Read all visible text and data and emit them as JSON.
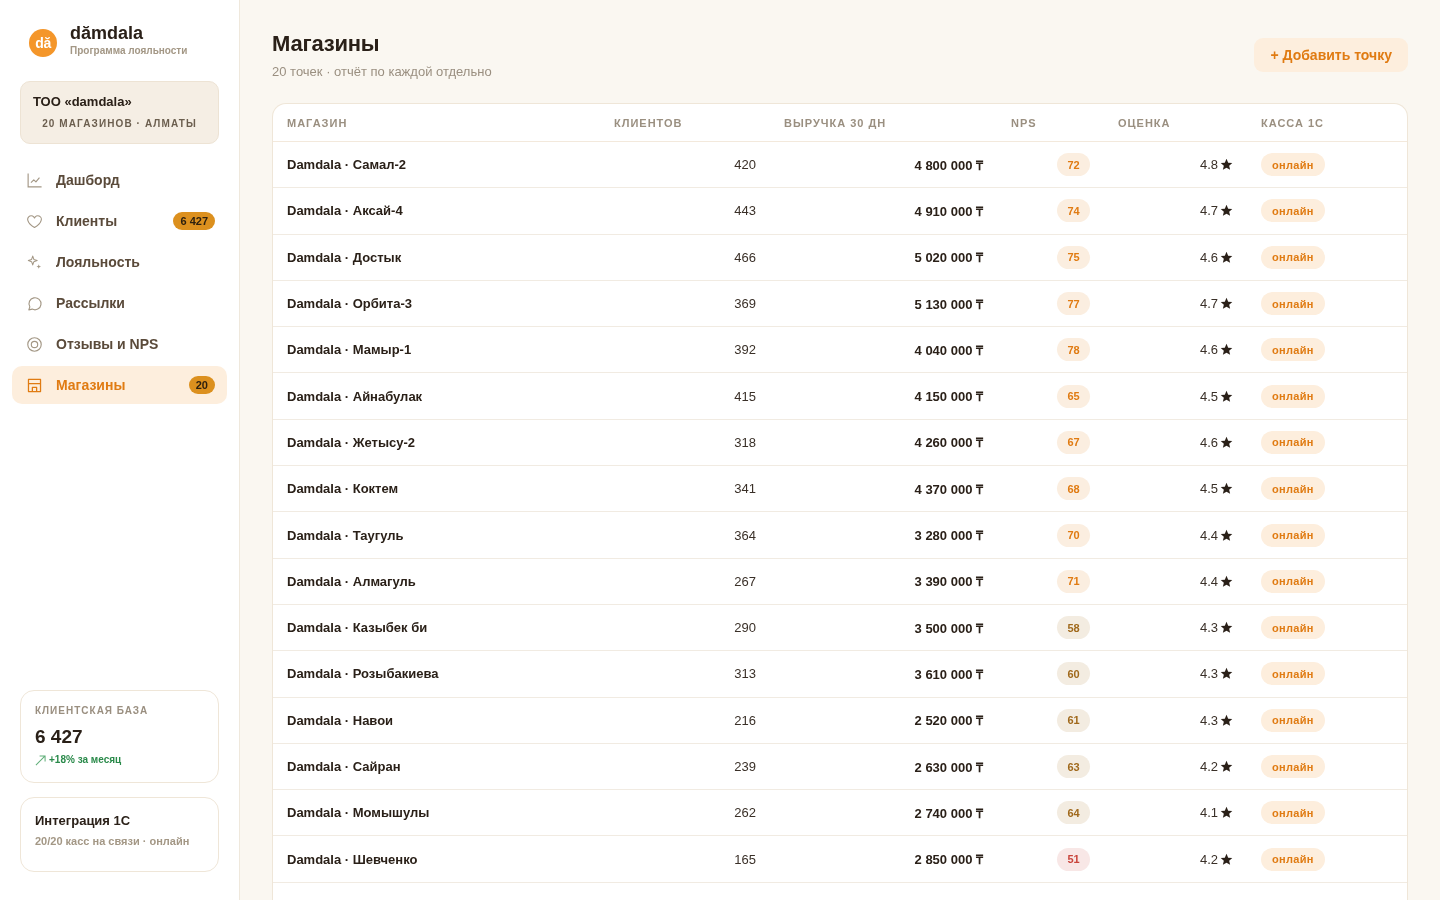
{
  "sidebar": {
    "logo": {
      "mark": "dă",
      "name": "dămdala",
      "tagline": "Программа лояльности"
    },
    "org": {
      "name": "ТОО «damdala»",
      "details": "20 МАГАЗИНОВ · АЛМАТЫ"
    },
    "nav": [
      {
        "label": "Дашборд",
        "selected": false
      },
      {
        "label": "Клиенты",
        "badge": "6 427",
        "selected": false
      },
      {
        "label": "Лояльность",
        "selected": false
      },
      {
        "label": "Рассылки",
        "selected": false
      },
      {
        "label": "Отзывы и NPS",
        "selected": false
      },
      {
        "label": "Магазины",
        "badge": "20",
        "selected": true
      }
    ],
    "client_base": {
      "label": "КЛИЕНТСКАЯ БАЗА",
      "value": "6 427",
      "trend": "+18% за месяц"
    },
    "integration": {
      "title": "Интеграция 1С",
      "status": "20/20 касс на связи · онлайн"
    }
  },
  "header": {
    "title": "Магазины",
    "subtitle": "20 точек · отчёт по каждой отдельно",
    "add_button": "+ Добавить точку"
  },
  "table": {
    "columns": [
      "МАГАЗИН",
      "КЛИЕНТОВ",
      "ВЫРУЧКА 30 ДН",
      "NPS",
      "ОЦЕНКА",
      "КАССА 1С"
    ],
    "rows": [
      {
        "name": "Damdala · Самал-2",
        "clients": "420",
        "revenue": "4 800 000 ₸",
        "nps": {
          "score": "72",
          "color": "#e07b12"
        },
        "rating": "4.8",
        "status": "онлайн"
      },
      {
        "name": "Damdala · Аксай-4",
        "clients": "443",
        "revenue": "4 910 000 ₸",
        "nps": {
          "score": "74",
          "color": "#e07b12"
        },
        "rating": "4.7",
        "status": "онлайн"
      },
      {
        "name": "Damdala · Достык",
        "clients": "466",
        "revenue": "5 020 000 ₸",
        "nps": {
          "score": "75",
          "color": "#e07b12"
        },
        "rating": "4.6",
        "status": "онлайн"
      },
      {
        "name": "Damdala · Орбита-3",
        "clients": "369",
        "revenue": "5 130 000 ₸",
        "nps": {
          "score": "77",
          "color": "#e07b12"
        },
        "rating": "4.7",
        "status": "онлайн"
      },
      {
        "name": "Damdala · Мамыр-1",
        "clients": "392",
        "revenue": "4 040 000 ₸",
        "nps": {
          "score": "78",
          "color": "#e07b12"
        },
        "rating": "4.6",
        "status": "онлайн"
      },
      {
        "name": "Damdala · Айнабулак",
        "clients": "415",
        "revenue": "4 150 000 ₸",
        "nps": {
          "score": "65",
          "color": "#e07b12"
        },
        "rating": "4.5",
        "status": "онлайн"
      },
      {
        "name": "Damdala · Жетысу-2",
        "clients": "318",
        "revenue": "4 260 000 ₸",
        "nps": {
          "score": "67",
          "color": "#e07b12"
        },
        "rating": "4.6",
        "status": "онлайн"
      },
      {
        "name": "Damdala · Коктем",
        "clients": "341",
        "revenue": "4 370 000 ₸",
        "nps": {
          "score": "68",
          "color": "#e07b12"
        },
        "rating": "4.5",
        "status": "онлайн"
      },
      {
        "name": "Damdala · Таугуль",
        "clients": "364",
        "revenue": "3 280 000 ₸",
        "nps": {
          "score": "70",
          "color": "#e07b12"
        },
        "rating": "4.4",
        "status": "онлайн"
      },
      {
        "name": "Damdala · Алмагуль",
        "clients": "267",
        "revenue": "3 390 000 ₸",
        "nps": {
          "score": "71",
          "color": "#e07b12"
        },
        "rating": "4.4",
        "status": "онлайн"
      },
      {
        "name": "Damdala · Казыбек би",
        "clients": "290",
        "revenue": "3 500 000 ₸",
        "nps": {
          "score": "58",
          "color": "#a0691c"
        },
        "rating": "4.3",
        "status": "онлайн"
      },
      {
        "name": "Damdala · Розыбакиева",
        "clients": "313",
        "revenue": "3 610 000 ₸",
        "nps": {
          "score": "60",
          "color": "#a0691c"
        },
        "rating": "4.3",
        "status": "онлайн"
      },
      {
        "name": "Damdala · Навои",
        "clients": "216",
        "revenue": "2 520 000 ₸",
        "nps": {
          "score": "61",
          "color": "#a0691c"
        },
        "rating": "4.3",
        "status": "онлайн"
      },
      {
        "name": "Damdala · Сайран",
        "clients": "239",
        "revenue": "2 630 000 ₸",
        "nps": {
          "score": "63",
          "color": "#a0691c"
        },
        "rating": "4.2",
        "status": "онлайн"
      },
      {
        "name": "Damdala · Момышулы",
        "clients": "262",
        "revenue": "2 740 000 ₸",
        "nps": {
          "score": "64",
          "color": "#a0691c"
        },
        "rating": "4.1",
        "status": "онлайн"
      },
      {
        "name": "Damdala · Шевченко",
        "clients": "165",
        "revenue": "2 850 000 ₸",
        "nps": {
          "score": "51",
          "color": "#c9453c"
        },
        "rating": "4.2",
        "status": "онлайн"
      }
    ]
  }
}
